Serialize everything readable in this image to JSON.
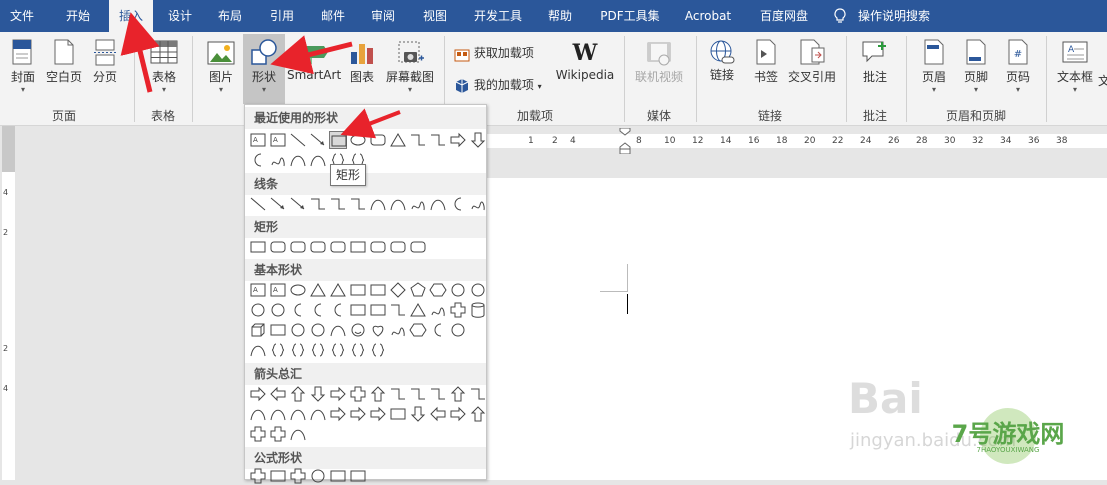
{
  "menu_tabs": [
    {
      "label": "文件"
    },
    {
      "label": "开始"
    },
    {
      "label": "插入"
    },
    {
      "label": "设计"
    },
    {
      "label": "布局"
    },
    {
      "label": "引用"
    },
    {
      "label": "邮件"
    },
    {
      "label": "审阅"
    },
    {
      "label": "视图"
    },
    {
      "label": "开发工具"
    },
    {
      "label": "帮助"
    },
    {
      "label": "PDF工具集"
    },
    {
      "label": "Acrobat"
    },
    {
      "label": "百度网盘"
    },
    {
      "label": "操作说明搜索"
    }
  ],
  "active_tab": "插入",
  "ribbon": {
    "cover": "封面",
    "blank_page": "空白页",
    "page_break": "分页",
    "group_pages": "页面",
    "table": "表格",
    "group_tables": "表格",
    "picture": "图片",
    "shapes": "形状",
    "smartart": "SmartArt",
    "chart": "图表",
    "screenshot": "屏幕截图",
    "get_addins": "获取加载项",
    "my_addins": "我的加载项",
    "wikipedia": "Wikipedia",
    "group_addins": "加载项",
    "online_video": "联机视频",
    "group_media": "媒体",
    "link": "链接",
    "bookmark": "书签",
    "crossref": "交叉引用",
    "group_links": "链接",
    "comment": "批注",
    "group_comments": "批注",
    "header": "页眉",
    "footer": "页脚",
    "page_number": "页码",
    "group_header_footer": "页眉和页脚",
    "textbox": "文本框",
    "textbox_more": "文"
  },
  "shapes_panel": {
    "recent": "最近使用的形状",
    "lines": "线条",
    "rectangles": "矩形",
    "basic": "基本形状",
    "arrows": "箭头总汇",
    "equation": "公式形状"
  },
  "tooltip": "矩形",
  "ruler": {
    "ticks": [
      "8",
      "10",
      "12",
      "14",
      "16",
      "18",
      "20",
      "22",
      "24",
      "26",
      "28",
      "30",
      "32",
      "34",
      "36",
      "38"
    ],
    "left_ticks": [
      "1",
      "2",
      "4"
    ],
    "vticks": [
      "4",
      "2",
      "2",
      "4"
    ]
  },
  "watermark": {
    "baidu": "Bai",
    "jingyan": "jingyan.baidu.com",
    "game_logo": "7号游戏网",
    "game_sub": "7HAOYOUXIWANG"
  },
  "colors": {
    "accent": "#2b579a",
    "annotation_arrow": "#e8232b"
  }
}
